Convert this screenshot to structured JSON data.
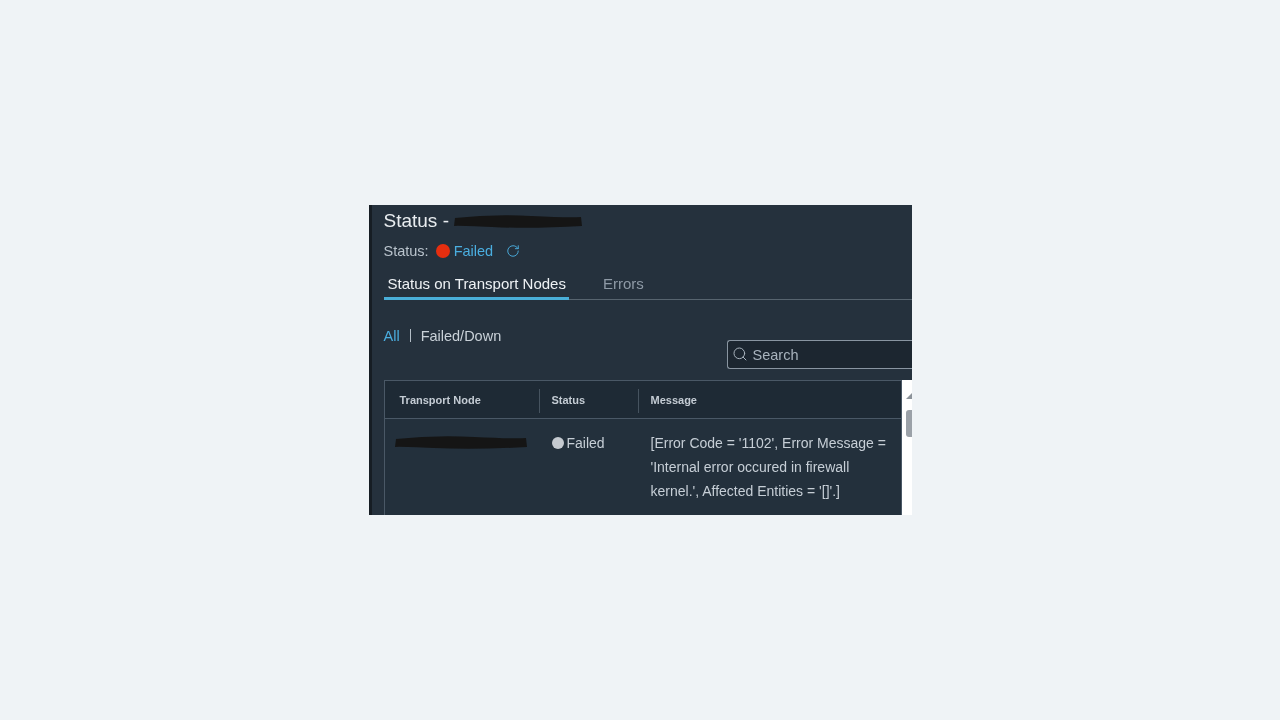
{
  "header": {
    "title": "Status -",
    "status_label": "Status:",
    "status": {
      "value": "Failed",
      "color": "#e62e0f"
    }
  },
  "tabs": [
    {
      "label": "Status on Transport Nodes",
      "selected": true
    },
    {
      "label": "Errors",
      "selected": false
    }
  ],
  "filters": [
    {
      "label": "All",
      "selected": true
    },
    {
      "label": "Failed/Down",
      "selected": false
    }
  ],
  "search": {
    "placeholder": "Search"
  },
  "table": {
    "columns": [
      "Transport Node",
      "Status",
      "Message"
    ],
    "rows": [
      {
        "status": "Failed",
        "color": "#c5cad0",
        "message": "[Error Code = '1102', Error Message = 'Internal error occured in firewall kernel.', Affected Entities = '[]'.]"
      }
    ]
  }
}
